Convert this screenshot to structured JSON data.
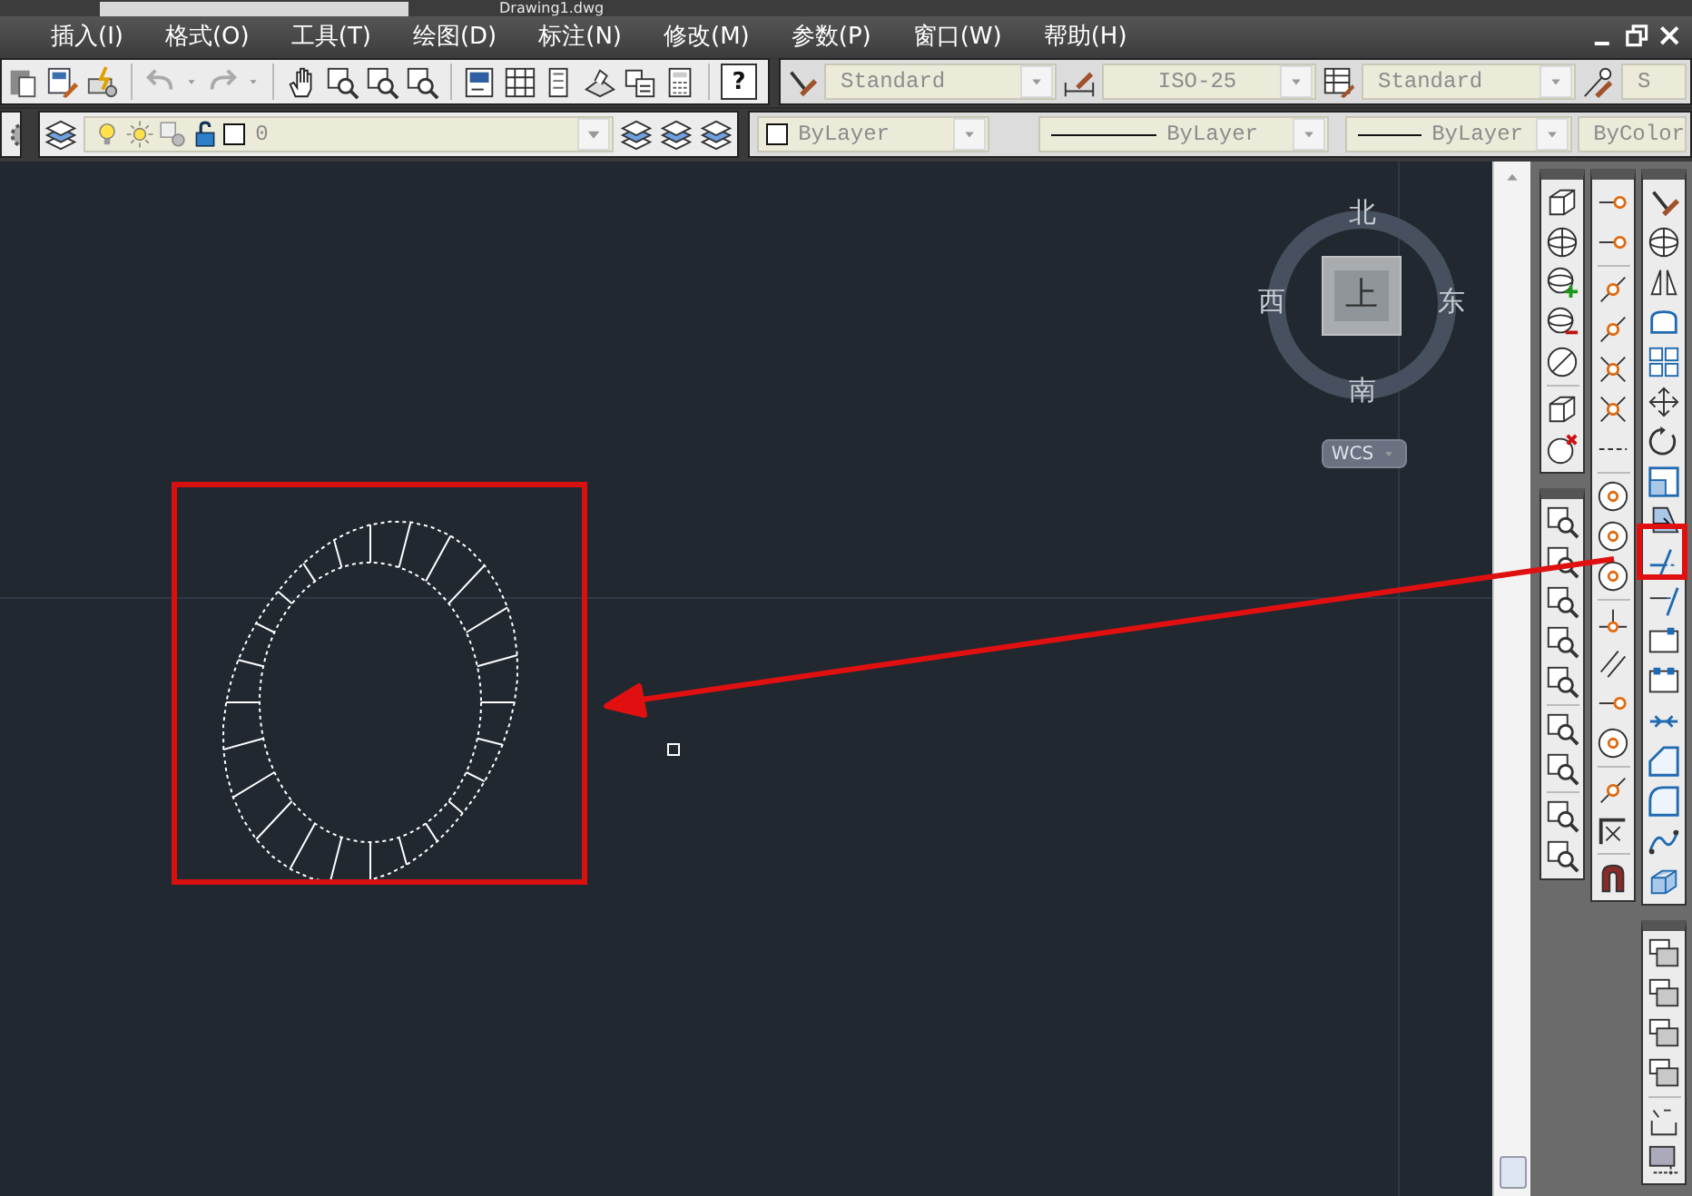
{
  "window": {
    "title": "Drawing1.dwg"
  },
  "menu": [
    {
      "label": "插入(I)"
    },
    {
      "label": "格式(O)"
    },
    {
      "label": "工具(T)"
    },
    {
      "label": "绘图(D)"
    },
    {
      "label": "标注(N)"
    },
    {
      "label": "修改(M)"
    },
    {
      "label": "参数(P)"
    },
    {
      "label": "窗口(W)"
    },
    {
      "label": "帮助(H)"
    }
  ],
  "standard_toolbar": {
    "help_button": "?"
  },
  "styles_toolbar": {
    "text_style": "Standard",
    "dimension_style": "ISO-25",
    "table_style": "Standard",
    "multileader_style": "S"
  },
  "layers_toolbar": {
    "current_layer": "0"
  },
  "properties_toolbar": {
    "object_color": "ByLayer",
    "linetype": "ByLayer",
    "lineweight": "ByLayer",
    "plot_style": "ByColor"
  },
  "viewcube": {
    "north": "北",
    "south": "南",
    "west": "西",
    "east": "东",
    "face": "上",
    "coordinate_system": "WCS"
  }
}
